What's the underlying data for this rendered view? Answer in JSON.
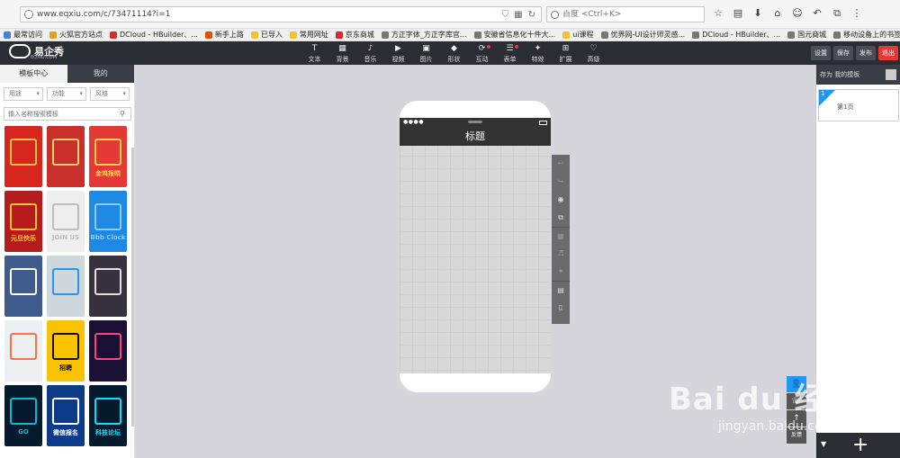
{
  "browser": {
    "url": "www.eqxiu.com/c/73471114?i=1",
    "search_placeholder": "百度 <Ctrl+K>",
    "bookmarks": [
      {
        "label": "最常访问",
        "color": "#4a7fd6"
      },
      {
        "label": "火狐官方站点",
        "color": "#e0a020"
      },
      {
        "label": "DCloud - HBuilder、...",
        "color": "#d32f2f"
      },
      {
        "label": "新手上路",
        "color": "#e65100"
      },
      {
        "label": "已导入",
        "color": "#f1c232"
      },
      {
        "label": "常用网址",
        "color": "#f1c232"
      },
      {
        "label": "京东商城",
        "color": "#d32f2f"
      },
      {
        "label": "方正字体_方正字库官...",
        "color": "#777777"
      },
      {
        "label": "安徽省信息化十件大...",
        "color": "#777777"
      },
      {
        "label": "ui课程",
        "color": "#f1c232"
      },
      {
        "label": "优界网-UI设计师灵感...",
        "color": "#777777"
      },
      {
        "label": "DCloud - HBuilder、...",
        "color": "#777777"
      },
      {
        "label": "国元商城",
        "color": "#777777"
      },
      {
        "label": "移动设备上的书签",
        "color": "#777777"
      }
    ]
  },
  "app": {
    "logo_text": "易企秀",
    "logo_sub": "EQXIU.COM",
    "tools": [
      {
        "label": "文本",
        "icon": "T",
        "dot": false
      },
      {
        "label": "背景",
        "icon": "▦",
        "dot": false
      },
      {
        "label": "音乐",
        "icon": "♪",
        "dot": false
      },
      {
        "label": "视频",
        "icon": "▶",
        "dot": false
      },
      {
        "label": "图片",
        "icon": "▣",
        "dot": false
      },
      {
        "label": "形状",
        "icon": "◆",
        "dot": false
      },
      {
        "label": "互动",
        "icon": "⟳",
        "dot": true
      },
      {
        "label": "表单",
        "icon": "☰",
        "dot": true
      },
      {
        "label": "特效",
        "icon": "✦",
        "dot": false
      },
      {
        "label": "扩展",
        "icon": "⊞",
        "dot": false
      },
      {
        "label": "高级",
        "icon": "♡",
        "dot": false
      }
    ],
    "buttons": {
      "settings": "设置",
      "save": "保存",
      "publish": "发布",
      "exit": "退出"
    }
  },
  "left_panel": {
    "tabs": [
      "模板中心",
      "我的"
    ],
    "filters": [
      "用途",
      "功能",
      "风格"
    ],
    "search_placeholder": "输入名称搜索模板",
    "thumbnails": [
      {
        "bg": "#d7261e",
        "accent": "#f5c542",
        "text": ""
      },
      {
        "bg": "#c9302c",
        "accent": "#f7d26a",
        "text": ""
      },
      {
        "bg": "#e53935",
        "accent": "#ffd54f",
        "text": "金鸡报晓"
      },
      {
        "bg": "#b71c1c",
        "accent": "#ffca28",
        "text": "元旦快乐"
      },
      {
        "bg": "#eeeeee",
        "accent": "#bdbdbd",
        "text": "JOIN US"
      },
      {
        "bg": "#1e88e5",
        "accent": "#90caf9",
        "text": "Bbb Clock"
      },
      {
        "bg": "#3f5a8c",
        "accent": "#ffffff",
        "text": ""
      },
      {
        "bg": "#cfd8dc",
        "accent": "#2196f3",
        "text": ""
      },
      {
        "bg": "#37323e",
        "accent": "#e0e0e0",
        "text": ""
      },
      {
        "bg": "#eceff1",
        "accent": "#ff7043",
        "text": ""
      },
      {
        "bg": "#f9c300",
        "accent": "#111111",
        "text": "招聘"
      },
      {
        "bg": "#1a1033",
        "accent": "#ff4081",
        "text": ""
      },
      {
        "bg": "#061a2e",
        "accent": "#00bcd4",
        "text": "GO"
      },
      {
        "bg": "#0d3b8a",
        "accent": "#ffffff",
        "text": "微信报名"
      },
      {
        "bg": "#061a2e",
        "accent": "#00e5ff",
        "text": "科技论坛"
      }
    ]
  },
  "canvas": {
    "title": "标题",
    "side_tools": [
      {
        "icon": "↩",
        "dim": true
      },
      {
        "icon": "↪",
        "dim": true
      },
      {
        "icon": "◉",
        "dim": false
      },
      {
        "icon": "⧉",
        "dim": false
      },
      {
        "icon": "▦",
        "dim": true
      },
      {
        "icon": "♬",
        "dim": true
      },
      {
        "icon": "✦",
        "dim": true
      },
      {
        "icon": "▤",
        "dim": false
      },
      {
        "icon": "▯",
        "dim": false
      }
    ]
  },
  "right_panel": {
    "header": "存为 我的模板",
    "page_number": "1",
    "page_label": "第1页",
    "feedback": "反馈"
  },
  "watermark": {
    "main": "Bai du 经验",
    "sub": "jingyan.baidu.com"
  }
}
